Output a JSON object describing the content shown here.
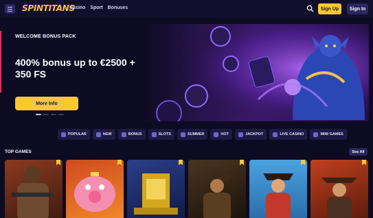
{
  "header": {
    "logo": "SPINTITANS",
    "nav": [
      "Casino",
      "Sport",
      "Bonuses"
    ],
    "signup_label": "Sign Up",
    "signin_label": "Sign In"
  },
  "hero": {
    "eyebrow": "WELCOME BONUS PACK",
    "title": "400% bonus up to €2500 + 350 FS",
    "button_label": "More Info"
  },
  "categories": [
    {
      "label": "POPULAR",
      "icon": "star-icon"
    },
    {
      "label": "NEW",
      "icon": "new-icon"
    },
    {
      "label": "BONUS",
      "icon": "bonus-icon"
    },
    {
      "label": "SLOTS",
      "icon": "slots-icon"
    },
    {
      "label": "SUMMER",
      "icon": "summer-icon"
    },
    {
      "label": "HOT",
      "icon": "fire-icon"
    },
    {
      "label": "JACKPOT",
      "icon": "jackpot-icon"
    },
    {
      "label": "LIVE CASINO",
      "icon": "live-casino-icon"
    },
    {
      "label": "MINI GAMES",
      "icon": "mini-games-icon"
    }
  ],
  "top_games": {
    "title": "TOP GAMES",
    "see_all_label": "See All"
  },
  "colors": {
    "accent": "#f9c833",
    "background": "#0d0b22",
    "chip": "#1e1a45"
  }
}
